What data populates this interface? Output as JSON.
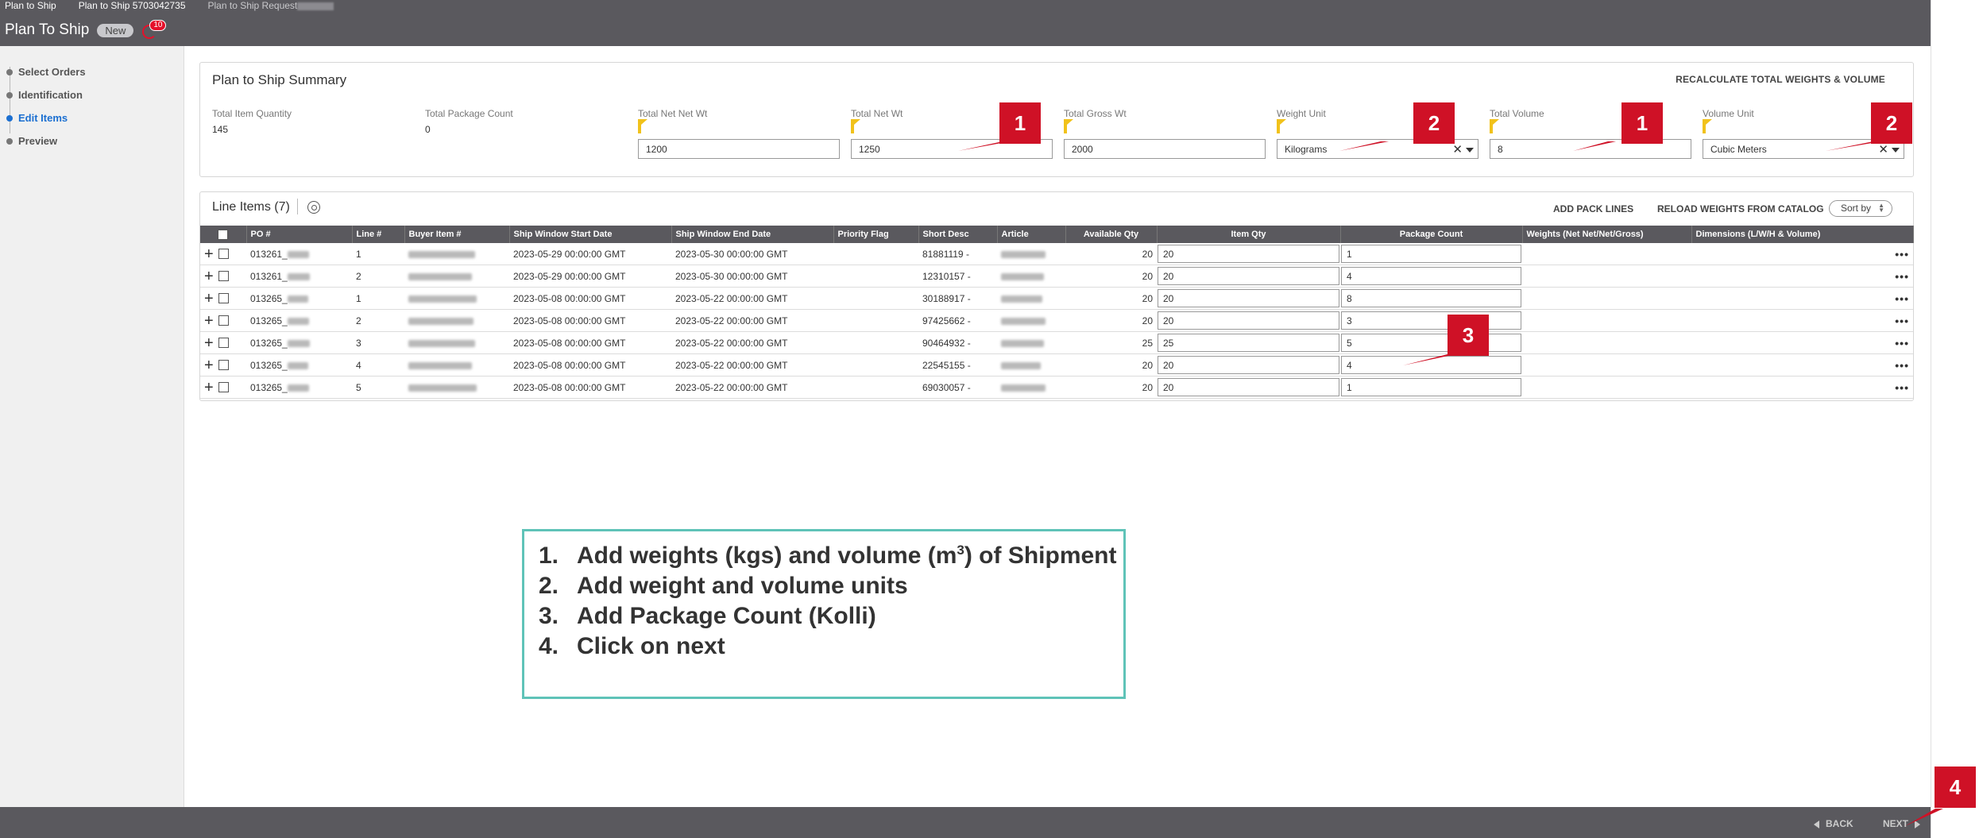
{
  "breadcrumbs": [
    "Plan to Ship",
    "Plan to Ship 5703042735",
    "Plan to Ship Request"
  ],
  "header": {
    "title": "Plan To Ship",
    "status_badge": "New",
    "notification_count": "10"
  },
  "steps": [
    {
      "label": "Select Orders",
      "active": false
    },
    {
      "label": "Identification",
      "active": false
    },
    {
      "label": "Edit Items",
      "active": true
    },
    {
      "label": "Preview",
      "active": false
    }
  ],
  "summary": {
    "title": "Plan to Ship Summary",
    "recalc_label": "RECALCULATE TOTAL WEIGHTS & VOLUME",
    "total_item_quantity": {
      "label": "Total Item Quantity",
      "value": "145"
    },
    "total_package_count": {
      "label": "Total Package Count",
      "value": "0"
    },
    "total_net_net_wt": {
      "label": "Total Net Net Wt",
      "value": "1200"
    },
    "total_net_wt": {
      "label": "Total Net Wt",
      "value": "1250"
    },
    "total_gross_wt": {
      "label": "Total Gross Wt",
      "value": "2000"
    },
    "weight_unit": {
      "label": "Weight Unit",
      "value": "Kilograms"
    },
    "total_volume": {
      "label": "Total Volume",
      "value": "8"
    },
    "volume_unit": {
      "label": "Volume Unit",
      "value": "Cubic Meters"
    }
  },
  "line_items": {
    "title": "Line Items (7)",
    "add_pack_lines": "ADD PACK LINES",
    "reload_weights": "RELOAD WEIGHTS FROM CATALOG",
    "sort_by": "Sort by",
    "columns": [
      "PO #",
      "Line #",
      "Buyer Item #",
      "Ship Window Start Date",
      "Ship Window End Date",
      "Priority Flag",
      "Short Desc",
      "Article",
      "Available Qty",
      "Item Qty",
      "Package Count",
      "Weights (Net Net/Net/Gross)",
      "Dimensions (L/W/H & Volume)"
    ],
    "rows": [
      {
        "po": "013261_",
        "line": "1",
        "start": "2023-05-29 00:00:00 GMT",
        "end": "2023-05-30 00:00:00 GMT",
        "short_desc": "81881119 -",
        "available_qty": "20",
        "item_qty": "20",
        "package_count": "1"
      },
      {
        "po": "013261_",
        "line": "2",
        "start": "2023-05-29 00:00:00 GMT",
        "end": "2023-05-30 00:00:00 GMT",
        "short_desc": "12310157 -",
        "available_qty": "20",
        "item_qty": "20",
        "package_count": "4"
      },
      {
        "po": "013265_",
        "line": "1",
        "start": "2023-05-08 00:00:00 GMT",
        "end": "2023-05-22 00:00:00 GMT",
        "short_desc": "30188917 -",
        "available_qty": "20",
        "item_qty": "20",
        "package_count": "8"
      },
      {
        "po": "013265_",
        "line": "2",
        "start": "2023-05-08 00:00:00 GMT",
        "end": "2023-05-22 00:00:00 GMT",
        "short_desc": "97425662 -",
        "available_qty": "20",
        "item_qty": "20",
        "package_count": "3"
      },
      {
        "po": "013265_",
        "line": "3",
        "start": "2023-05-08 00:00:00 GMT",
        "end": "2023-05-22 00:00:00 GMT",
        "short_desc": "90464932 -",
        "available_qty": "25",
        "item_qty": "25",
        "package_count": "5"
      },
      {
        "po": "013265_",
        "line": "4",
        "start": "2023-05-08 00:00:00 GMT",
        "end": "2023-05-22 00:00:00 GMT",
        "short_desc": "22545155 -",
        "available_qty": "20",
        "item_qty": "20",
        "package_count": "4"
      },
      {
        "po": "013265_",
        "line": "5",
        "start": "2023-05-08 00:00:00 GMT",
        "end": "2023-05-22 00:00:00 GMT",
        "short_desc": "69030057 -",
        "available_qty": "20",
        "item_qty": "20",
        "package_count": "1"
      }
    ]
  },
  "instructions": {
    "item1_text": "Add weights (kgs) and volume (m",
    "item1_sup": "3",
    "item1_tail": ") of Shipment",
    "item2_text": "Add weight and volume units",
    "item3_text": "Add Package Count (Kolli)",
    "item4_text": "Click on next"
  },
  "markers": {
    "m1": "1",
    "m2": "2",
    "m3": "3",
    "m4": "4"
  },
  "footer": {
    "back_label": "BACK",
    "next_label": "NEXT"
  },
  "colors": {
    "marker_red": "#cf1126",
    "callout_border": "#5fc3b8",
    "topbar": "#5a595e",
    "active_step": "#1b6fd1",
    "required_flag": "#f1c21b"
  }
}
